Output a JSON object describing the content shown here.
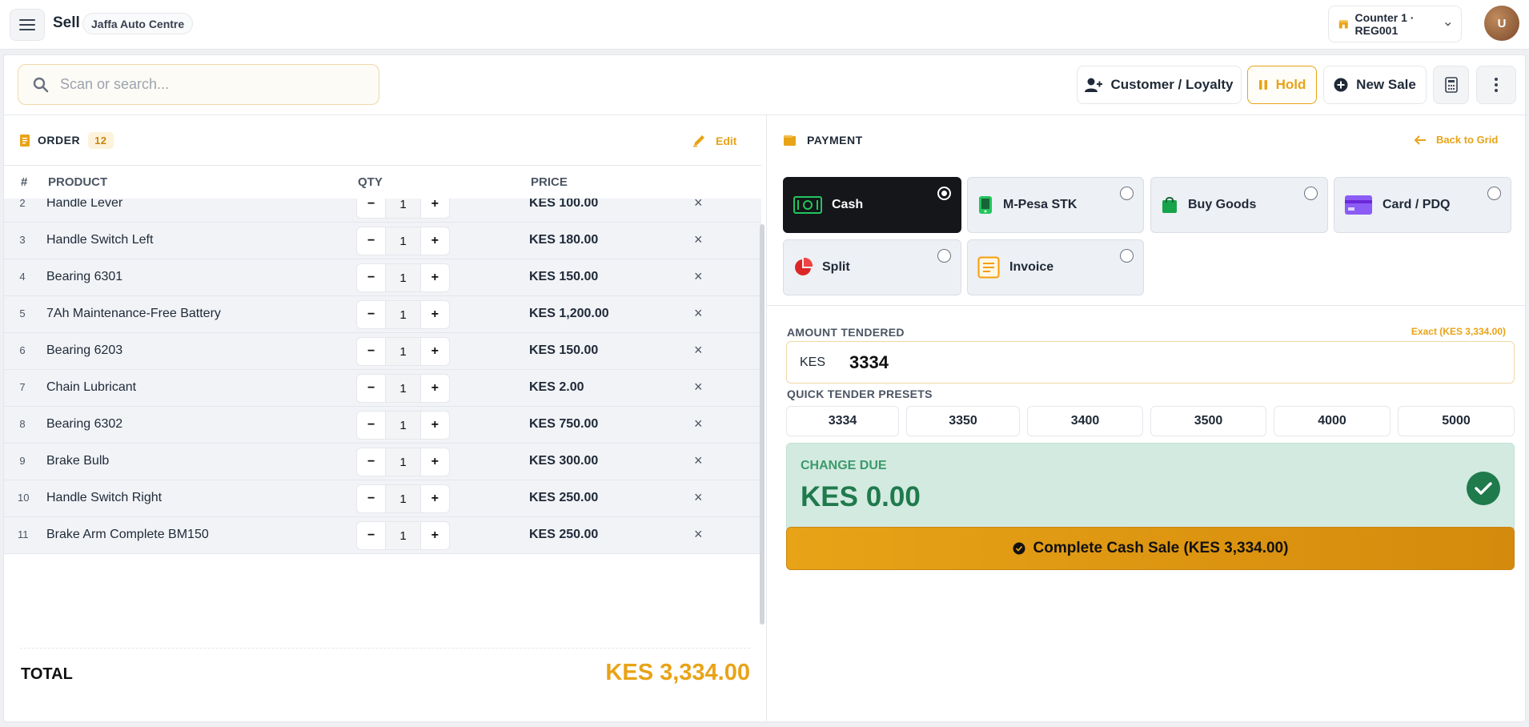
{
  "header": {
    "title": "Sell",
    "store": "Jaffa Auto Centre",
    "counter": "Counter 1 · REG001",
    "avatar_initial": "U"
  },
  "toolbar": {
    "search_placeholder": "Scan or search...",
    "customer_label": "Customer / Loyalty",
    "hold_label": "Hold",
    "new_sale_label": "New Sale"
  },
  "order": {
    "heading": "ORDER",
    "count": "12",
    "edit_label": "Edit",
    "columns": {
      "index": "#",
      "product": "PRODUCT",
      "qty": "QTY",
      "price": "PRICE"
    },
    "items": [
      {
        "index": "2",
        "name": "Handle Lever",
        "qty": "1",
        "price": "KES 100.00"
      },
      {
        "index": "3",
        "name": "Handle Switch Left",
        "qty": "1",
        "price": "KES 180.00"
      },
      {
        "index": "4",
        "name": "Bearing 6301",
        "qty": "1",
        "price": "KES 150.00"
      },
      {
        "index": "5",
        "name": "7Ah Maintenance-Free Battery",
        "qty": "1",
        "price": "KES 1,200.00"
      },
      {
        "index": "6",
        "name": "Bearing 6203",
        "qty": "1",
        "price": "KES 150.00"
      },
      {
        "index": "7",
        "name": "Chain Lubricant",
        "qty": "1",
        "price": "KES 2.00"
      },
      {
        "index": "8",
        "name": "Bearing 6302",
        "qty": "1",
        "price": "KES 750.00"
      },
      {
        "index": "9",
        "name": "Brake Bulb",
        "qty": "1",
        "price": "KES 300.00"
      },
      {
        "index": "10",
        "name": "Handle Switch Right",
        "qty": "1",
        "price": "KES 250.00"
      },
      {
        "index": "11",
        "name": "Brake Arm Complete BM150",
        "qty": "1",
        "price": "KES 250.00"
      }
    ],
    "minus_symbol": "−",
    "plus_symbol": "+",
    "remove_symbol": "×",
    "total_label": "TOTAL",
    "total_value": "KES 3,334.00"
  },
  "payment": {
    "heading": "PAYMENT",
    "back_label": "Back to Grid",
    "methods": [
      {
        "label": "Cash",
        "selected": true
      },
      {
        "label": "M-Pesa STK",
        "selected": false
      },
      {
        "label": "Buy Goods",
        "selected": false
      },
      {
        "label": "Card / PDQ",
        "selected": false
      },
      {
        "label": "Split",
        "selected": false
      },
      {
        "label": "Invoice",
        "selected": false
      }
    ],
    "amount_label": "AMOUNT TENDERED",
    "exact_label": "Exact (KES 3,334.00)",
    "currency": "KES",
    "amount_value": "3334",
    "presets_label": "QUICK TENDER PRESETS",
    "presets": [
      "3334",
      "3350",
      "3400",
      "3500",
      "4000",
      "5000"
    ],
    "change_label": "CHANGE DUE",
    "change_value": "KES 0.00",
    "complete_label": "Complete Cash Sale (KES 3,334.00)"
  },
  "colors": {
    "accent": "#e8a317",
    "success": "#1f7a4c",
    "selected_method": "#14161a"
  }
}
